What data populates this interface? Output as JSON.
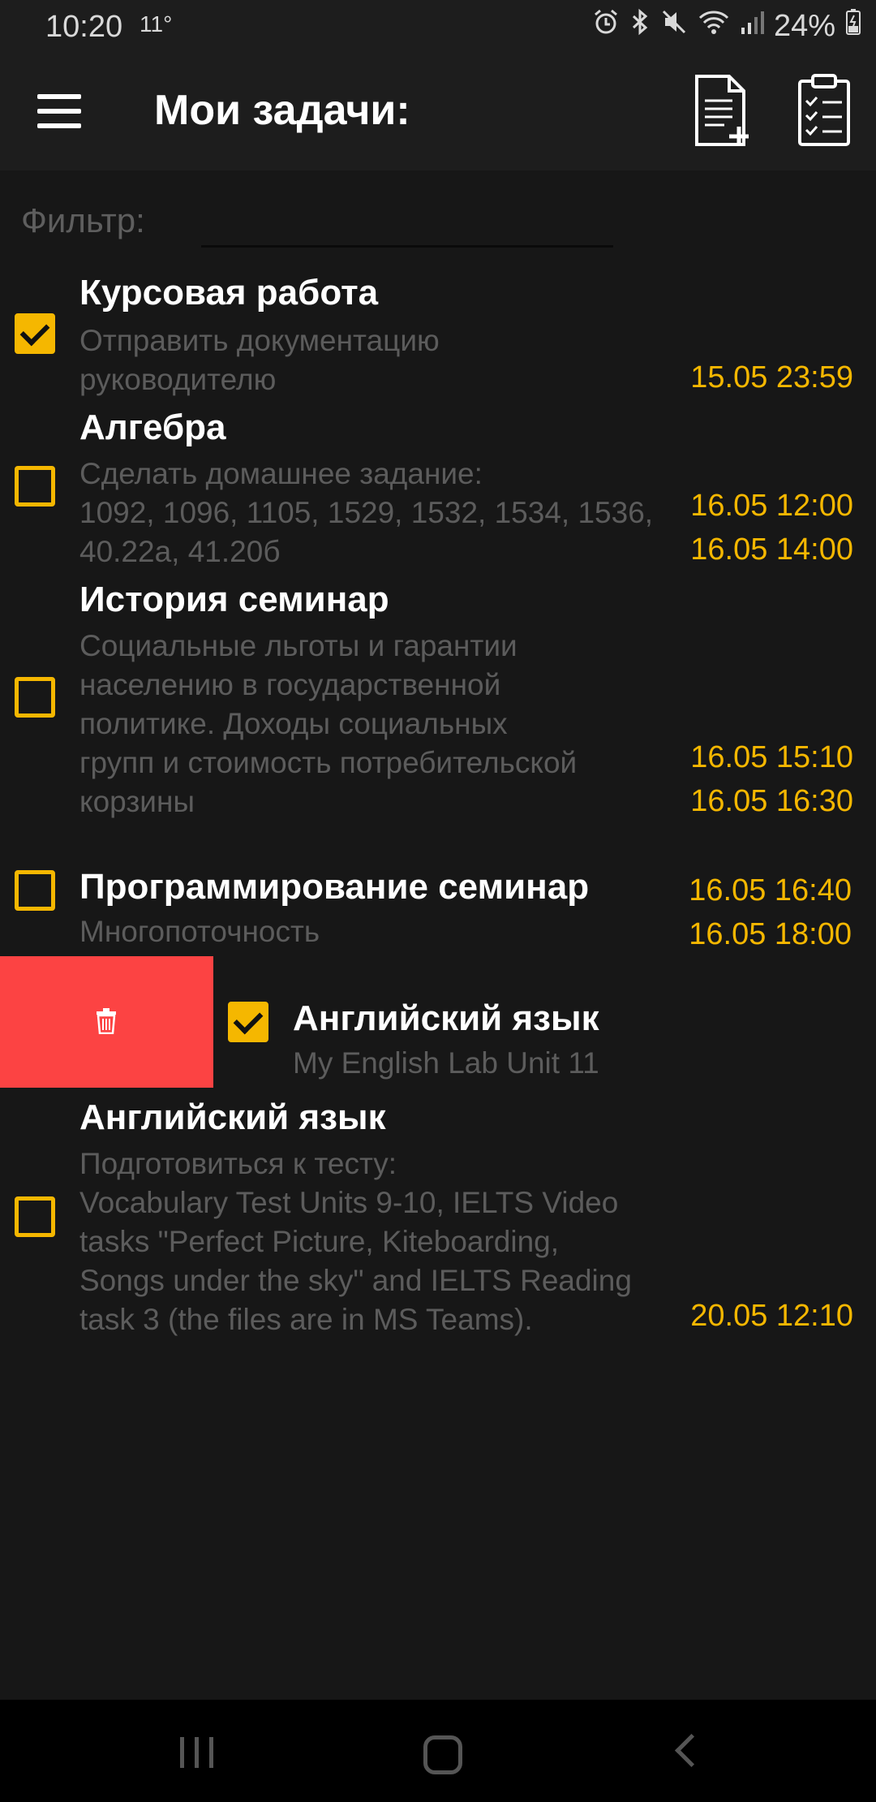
{
  "status_bar": {
    "time": "10:20",
    "temperature": "11°",
    "battery": "24%"
  },
  "app_bar": {
    "title": "Мои задачи:"
  },
  "filter": {
    "label": "Фильтр:",
    "value": ""
  },
  "tasks": [
    {
      "title": "Курсовая работа",
      "description": "Отправить документацию\nруководителю",
      "checked": true,
      "dates": [
        "15.05 23:59"
      ]
    },
    {
      "title": "Алгебра",
      "description": "Сделать домашнее задание:\n1092, 1096, 1105, 1529, 1532, 1534, 1536,\n40.22а, 41.20б",
      "checked": false,
      "dates": [
        "16.05 12:00",
        "16.05 14:00"
      ]
    },
    {
      "title": "История семинар",
      "description": "Социальные льготы и гарантии\nнаселению в государственной\nполитике. Доходы социальных\nгрупп и стоимость потребительской\nкорзины",
      "checked": false,
      "dates": [
        "16.05 15:10",
        "16.05 16:30"
      ]
    },
    {
      "title": "Программирование семинар",
      "description": "Многопоточность",
      "checked": false,
      "dates": [
        "16.05 16:40",
        "16.05 18:00"
      ]
    },
    {
      "title": "Английский язык",
      "description": "My English Lab Unit 11",
      "checked": true,
      "dates": [],
      "swiped": true
    },
    {
      "title": "Английский язык",
      "description": "Подготовиться к тесту:\nVocabulary Test Units 9-10, IELTS Video\ntasks \"Perfect Picture, Kiteboarding,\nSongs under the sky\" and IELTS Reading\ntask 3 (the files are in MS Teams).",
      "checked": false,
      "dates": [
        "20.05 12:10"
      ]
    }
  ],
  "colors": {
    "accent": "#f5b700",
    "background": "#171717",
    "delete": "#fc4343"
  }
}
